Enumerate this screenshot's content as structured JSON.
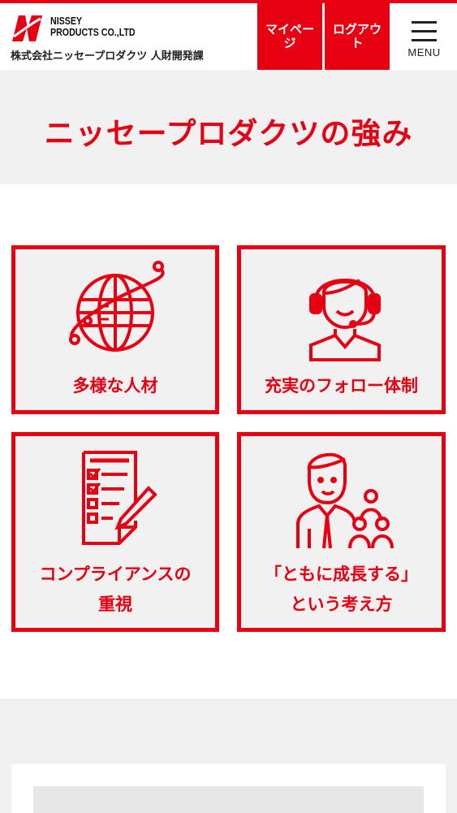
{
  "header": {
    "logo_line1": "NISSEY",
    "logo_line2": "PRODUCTS CO.,LTD",
    "department": "株式会社ニッセープロダクツ 人財開発課",
    "mypage_label": "マイページ",
    "logout_label": "ログアウト",
    "menu_label": "MENU"
  },
  "hero": {
    "title": "ニッセープロダクツの強み"
  },
  "strengths": [
    {
      "icon": "globe-icon",
      "label": "多様な人材"
    },
    {
      "icon": "headset-operator-icon",
      "label": "充実のフォロー体制"
    },
    {
      "icon": "checklist-icon",
      "label_line1": "コンプライアンスの",
      "label_line2": "重視"
    },
    {
      "icon": "mentor-team-icon",
      "label_line1": "「ともに成長する」",
      "label_line2": "という考え方"
    }
  ],
  "colors": {
    "accent": "#e60012",
    "panel_bg": "#f1f1f1",
    "text_dark": "#222222"
  }
}
